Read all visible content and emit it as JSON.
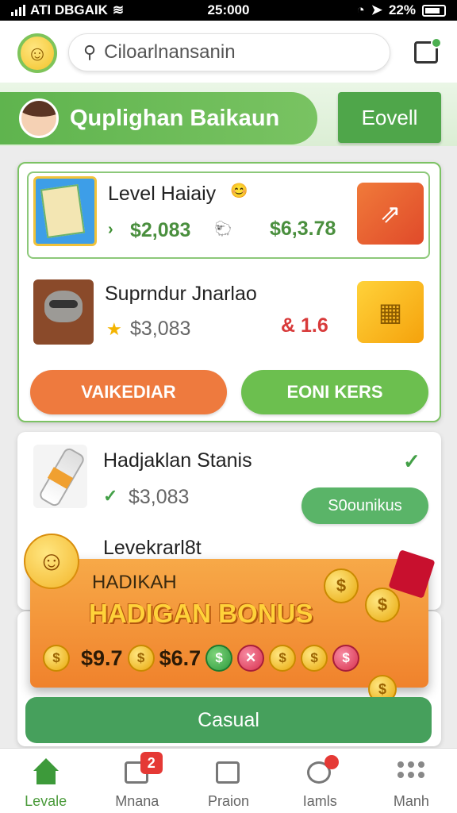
{
  "status_bar": {
    "carrier": "ATI DBGAIK",
    "time": "25:000",
    "battery": "22%"
  },
  "header": {
    "search_text": "Ciloarlnansanin"
  },
  "banner": {
    "title": "Quplighan Baikaun",
    "button": "Eovell"
  },
  "featured_card": {
    "items": [
      {
        "title": "Level Haiaiy",
        "price": "$2,083",
        "price_right": "$6,3.78"
      },
      {
        "title": "Suprndur Jnarlao",
        "price": "$3,083",
        "price_right": "& 1.6"
      }
    ],
    "button_left": "VAIKEDIAR",
    "button_right": "EONI KERS"
  },
  "list_card": {
    "item_title": "Hadjaklan Stanis",
    "item_price": "$3,083",
    "item_button": "S0ounikus",
    "next_title": "Levekrarl8t"
  },
  "bonus_popup": {
    "small_title": "HADIKAH",
    "big_title": "HADIGAN BONUS",
    "amount_1": "$9.7",
    "amount_2": "$6.7"
  },
  "action_button": "Casual",
  "tabs": [
    {
      "label": "Levale",
      "active": true
    },
    {
      "label": "Mnana",
      "badge": "2"
    },
    {
      "label": "Praion"
    },
    {
      "label": "Iamls"
    },
    {
      "label": "Manh"
    }
  ],
  "colors": {
    "accent_green": "#5fb44e",
    "orange": "#ee7a3e",
    "red_badge": "#e53935"
  }
}
